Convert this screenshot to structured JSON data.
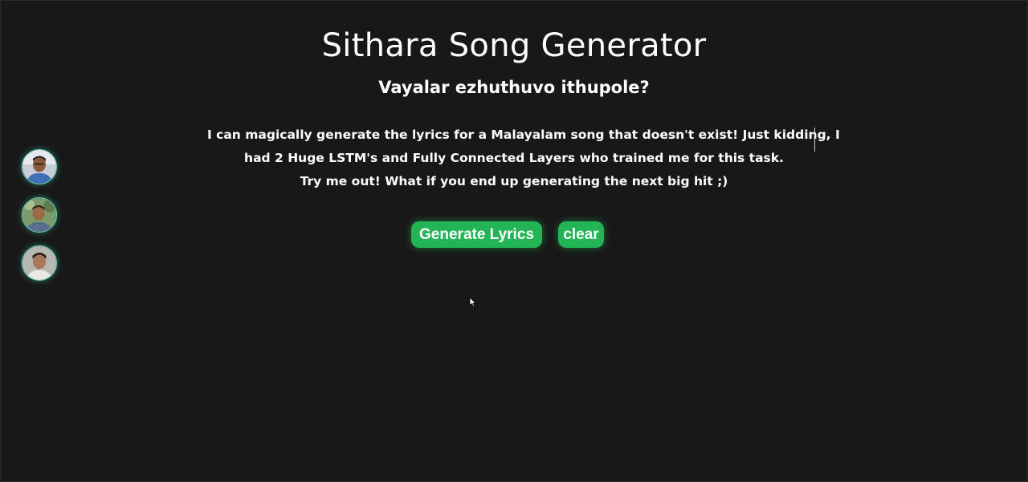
{
  "header": {
    "title": "Sithara Song Generator",
    "subtitle": "Vayalar ezhuthuvo ithupole?"
  },
  "description": {
    "line1": "I can magically generate the lyrics for a Malayalam song that doesn't exist! Just kidding, I",
    "line2": "had 2 Huge LSTM's and Fully Connected Layers who trained me for this task.",
    "line3": "Try me out! What if you end up generating the next big hit ;)"
  },
  "actions": {
    "generate_label": "Generate Lyrics",
    "clear_label": "clear"
  },
  "sidebar": {
    "avatars": [
      {
        "icon": "person-avatar-1"
      },
      {
        "icon": "person-avatar-2"
      },
      {
        "icon": "person-avatar-3"
      }
    ]
  },
  "colors": {
    "background": "#181818",
    "accent": "#22b455",
    "text": "#ffffff",
    "avatar_glow": "#6fd9c4"
  }
}
